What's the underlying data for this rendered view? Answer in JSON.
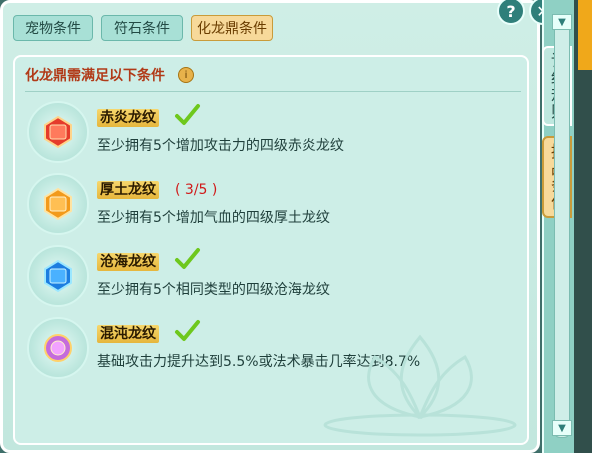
{
  "tabs": [
    {
      "label": "宠物条件",
      "active": false
    },
    {
      "label": "符石条件",
      "active": false
    },
    {
      "label": "化龙鼎条件",
      "active": true
    }
  ],
  "header": {
    "help_icon": "?",
    "close_icon": "✕"
  },
  "panel": {
    "title": "化龙鼎需满足以下条件",
    "info_icon": "i",
    "conditions": [
      {
        "name": "赤炎龙纹",
        "status": "done",
        "progress": "",
        "desc": "至少拥有5个增加攻击力的四级赤炎龙纹",
        "gem": "red-gem-icon"
      },
      {
        "name": "厚土龙纹",
        "status": "progress",
        "progress": "( 3/5 )",
        "desc": "至少拥有5个增加气血的四级厚土龙纹",
        "gem": "orange-gem-icon"
      },
      {
        "name": "沧海龙纹",
        "status": "done",
        "progress": "",
        "desc": "至少拥有5个相同类型的四级沧海龙纹",
        "gem": "blue-gem-icon"
      },
      {
        "name": "混沌龙纹",
        "status": "done",
        "progress": "",
        "desc": "基础攻击力提升达到5.5%或法术暴击几率达到8.7%",
        "gem": "purple-gem-icon"
      }
    ]
  },
  "side_tabs": [
    {
      "label": "详细规则",
      "active": false
    },
    {
      "label": "挑战条件",
      "active": true
    }
  ],
  "colors": {
    "accent": "#f7d99a",
    "panel": "#cdeee7",
    "title": "#b13a18",
    "progress": "#d01a1a"
  }
}
